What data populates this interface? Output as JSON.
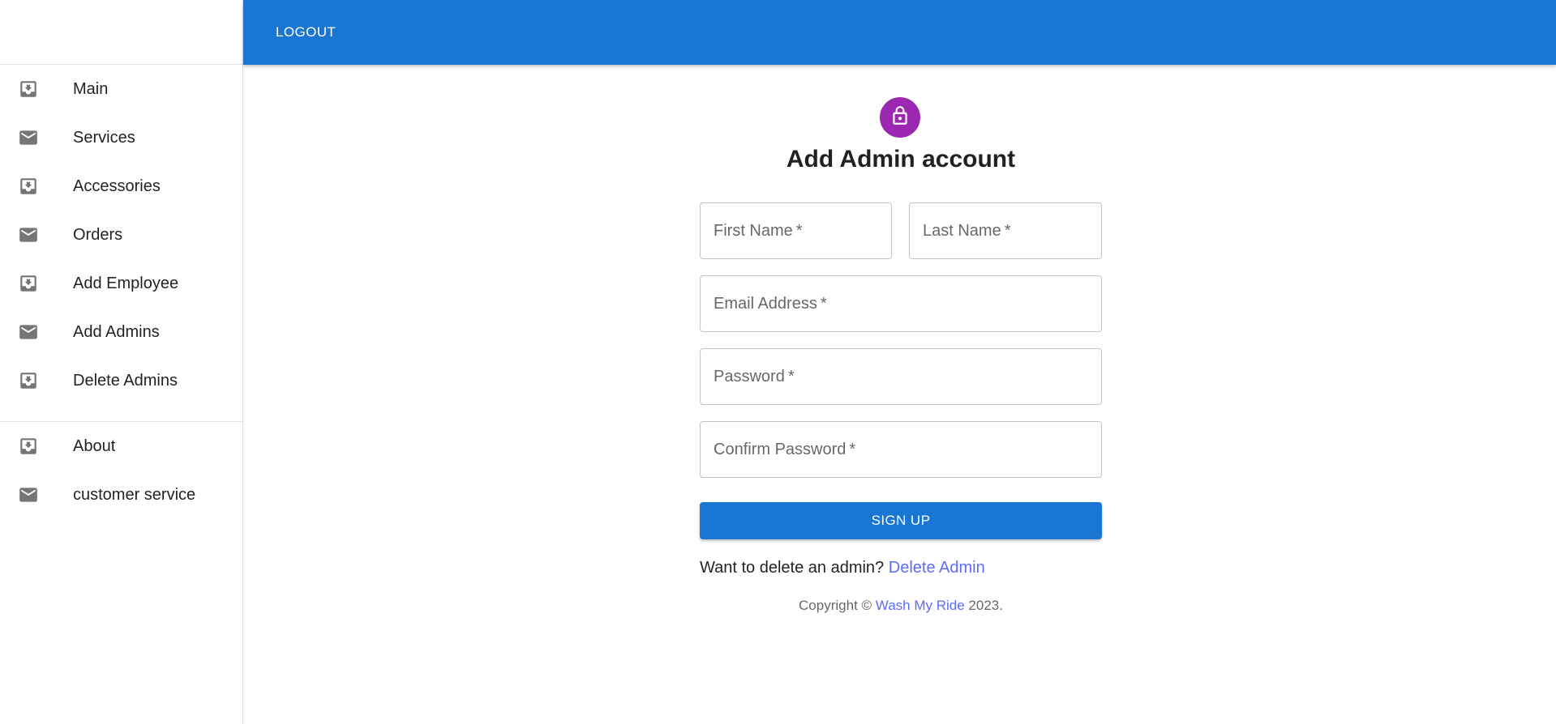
{
  "colors": {
    "appbar": "#1976d2",
    "avatar": "#9c27b0",
    "link": "#5c6bff",
    "icon": "#757575"
  },
  "appbar": {
    "logout_label": "LOGOUT"
  },
  "sidebar": {
    "primary_items": [
      {
        "label": "Main",
        "icon": "move-to-inbox-icon"
      },
      {
        "label": "Services",
        "icon": "mail-icon"
      },
      {
        "label": "Accessories",
        "icon": "move-to-inbox-icon"
      },
      {
        "label": "Orders",
        "icon": "mail-icon"
      },
      {
        "label": "Add Employee",
        "icon": "move-to-inbox-icon"
      },
      {
        "label": "Add Admins",
        "icon": "mail-icon"
      },
      {
        "label": "Delete Admins",
        "icon": "move-to-inbox-icon"
      }
    ],
    "secondary_items": [
      {
        "label": "About",
        "icon": "move-to-inbox-icon"
      },
      {
        "label": "customer service",
        "icon": "mail-icon"
      }
    ]
  },
  "form": {
    "avatar_icon": "lock-icon",
    "title": "Add Admin account",
    "fields": {
      "first_name": {
        "placeholder": "First Name",
        "required": "*",
        "value": ""
      },
      "last_name": {
        "placeholder": "Last Name",
        "required": "*",
        "value": ""
      },
      "email": {
        "placeholder": "Email Address",
        "required": "*",
        "value": ""
      },
      "password": {
        "placeholder": "Password",
        "required": "*",
        "value": ""
      },
      "confirm_password": {
        "placeholder": "Confirm Password",
        "required": "*",
        "value": ""
      }
    },
    "submit_label": "SIGN UP",
    "delete_prompt": "Want to delete an admin?",
    "delete_link": "Delete Admin"
  },
  "footer": {
    "copyright_prefix": "Copyright ©",
    "brand_link": "Wash My Ride",
    "year_suffix": "2023."
  }
}
